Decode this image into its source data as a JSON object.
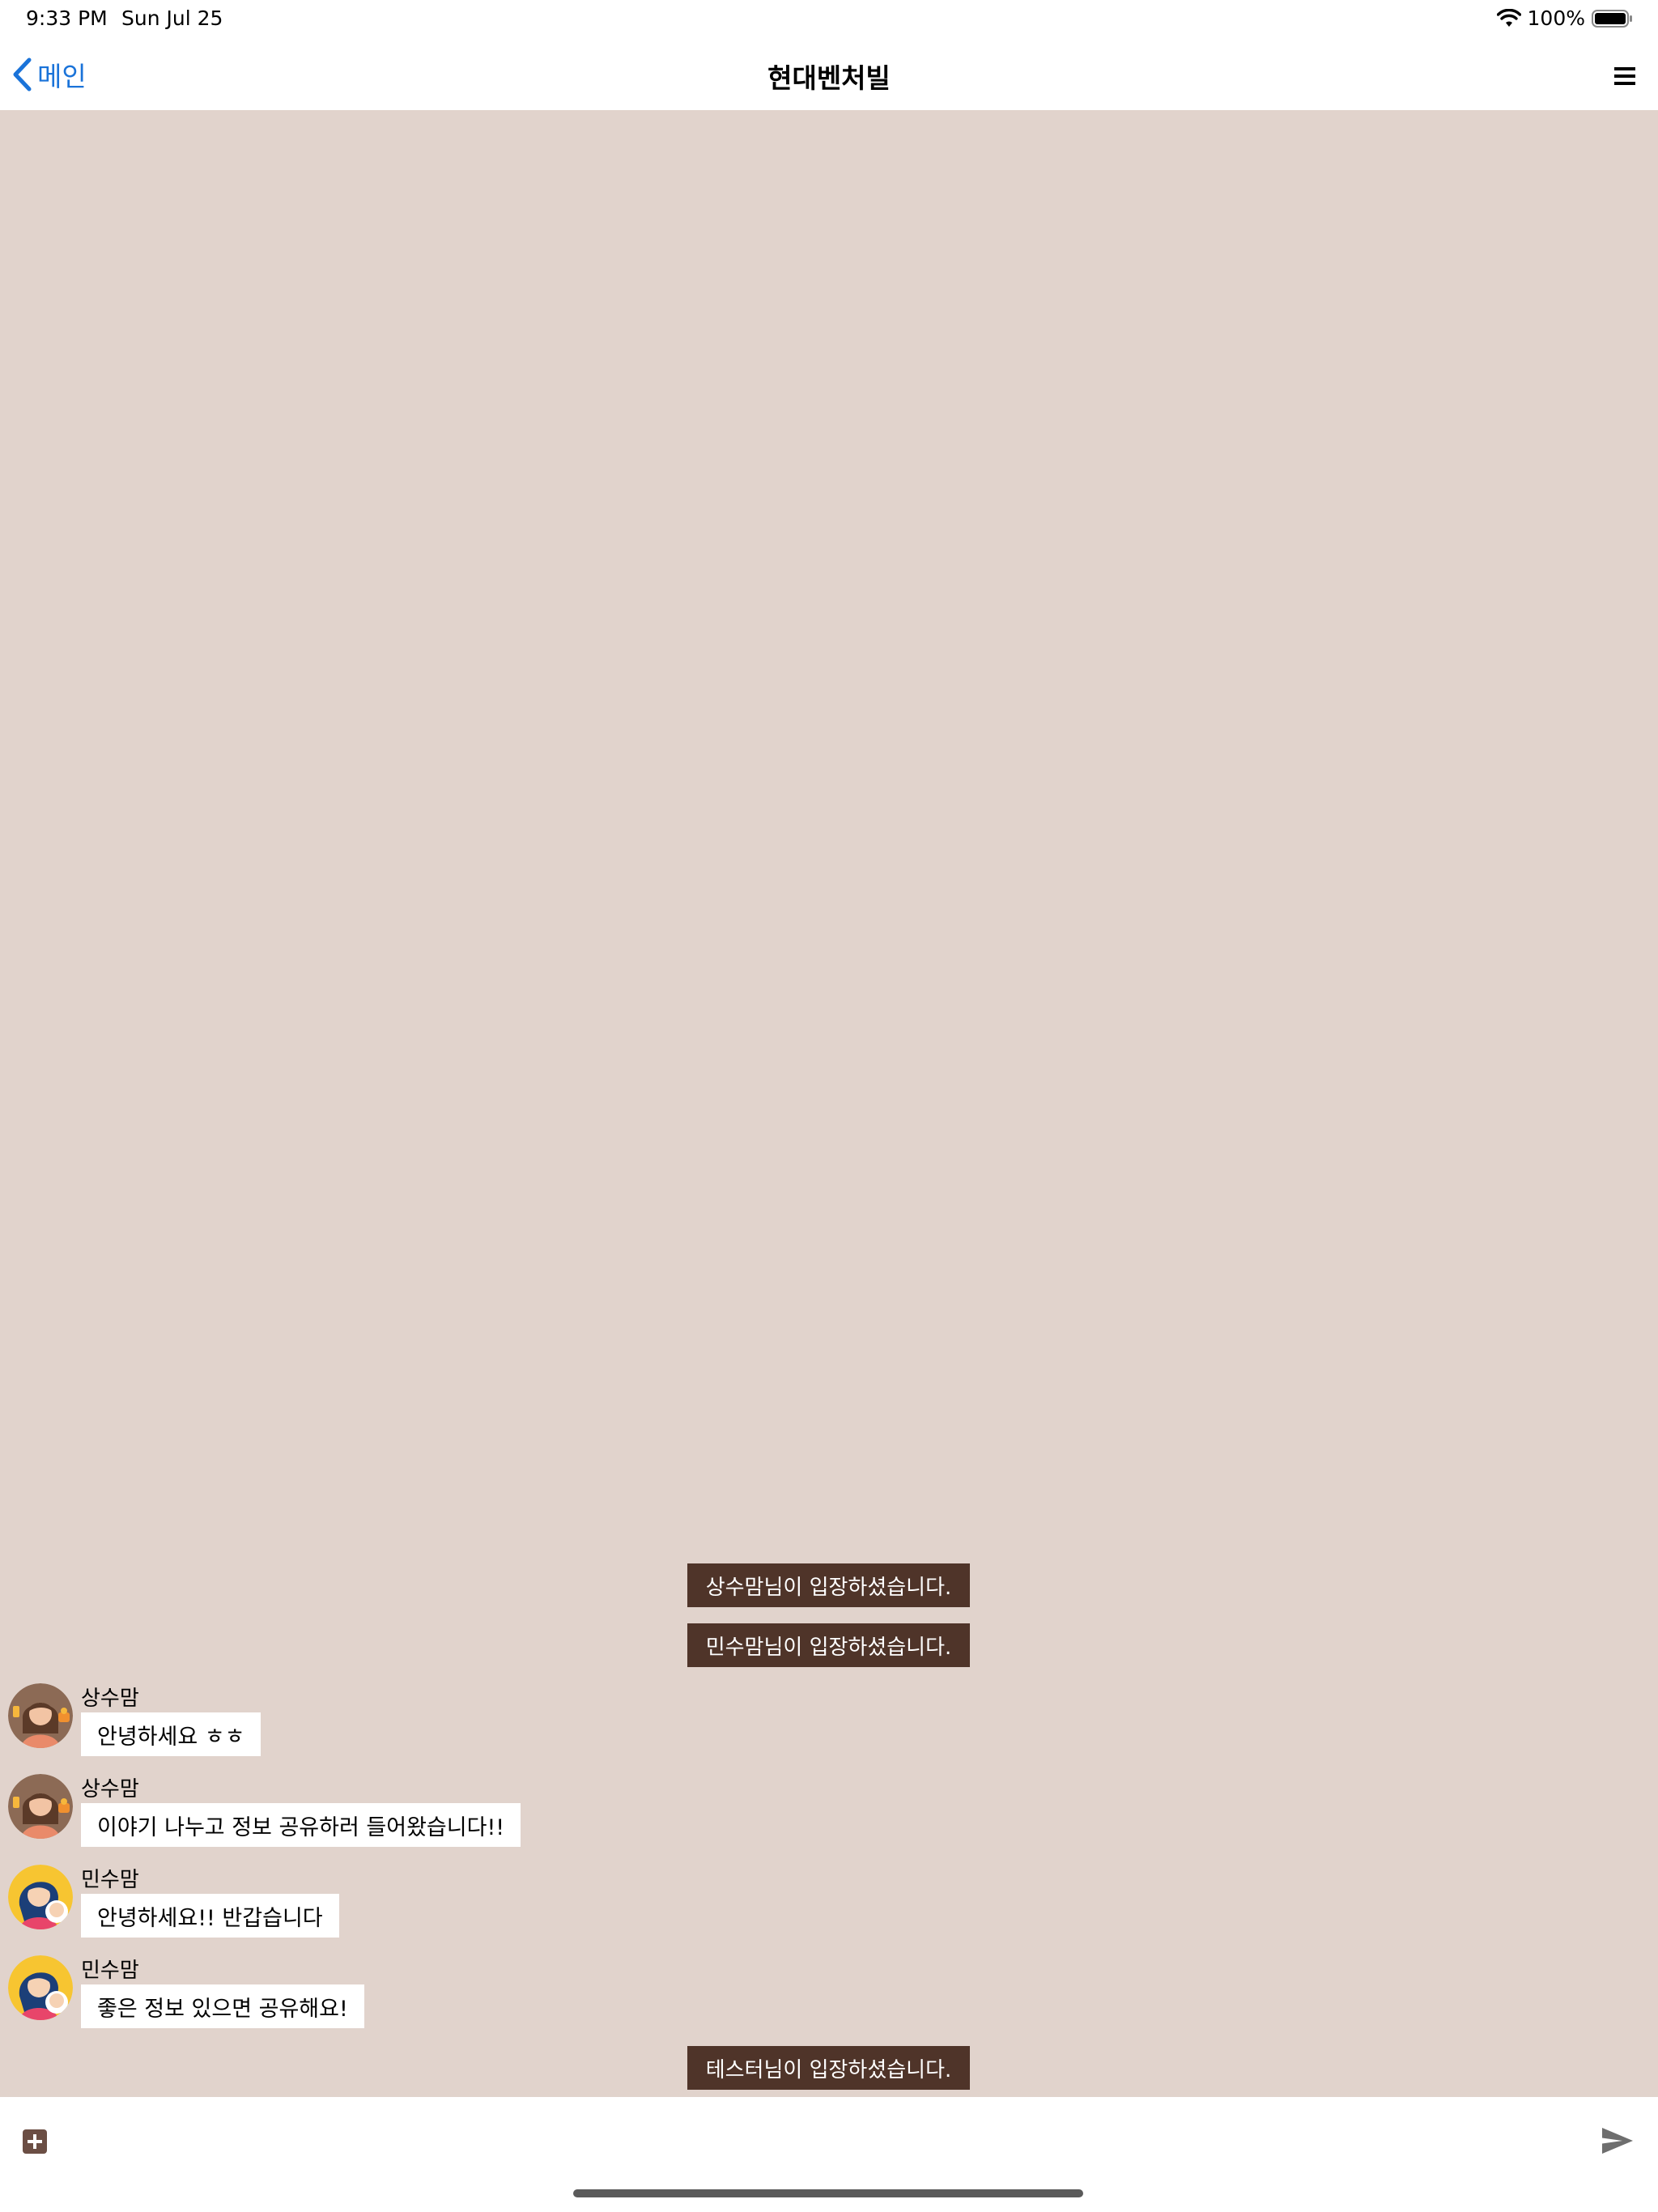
{
  "status_bar": {
    "time": "9:33 PM",
    "date": "Sun Jul 25",
    "battery": "100%",
    "icons": [
      "wifi-icon",
      "battery-icon"
    ]
  },
  "nav": {
    "back_label": "메인",
    "title": "현대벤처빌",
    "icons": [
      "chevron-left-icon",
      "hamburger-menu-icon"
    ],
    "accent_color": "#1a73d9"
  },
  "chat": {
    "background_color": "#e1d3cc",
    "notice_color": "#4f3429",
    "notices": [
      "상수맘님이 입장하셨습니다.",
      "민수맘님이 입장하셨습니다.",
      "테스터님이 입장하셨습니다."
    ],
    "messages": [
      {
        "sender": "상수맘",
        "text": "안녕하세요 ㅎㅎ"
      },
      {
        "sender": "상수맘",
        "text": "이야기 나누고 정보 공유하러 들어왔습니다!!"
      },
      {
        "sender": "민수맘",
        "text": "안녕하세요!! 반갑습니다"
      },
      {
        "sender": "민수맘",
        "text": "좋은 정보 있으면 공유해요!"
      }
    ]
  },
  "composer": {
    "placeholder": "",
    "icons": [
      "plus-square-icon",
      "send-icon"
    ]
  }
}
